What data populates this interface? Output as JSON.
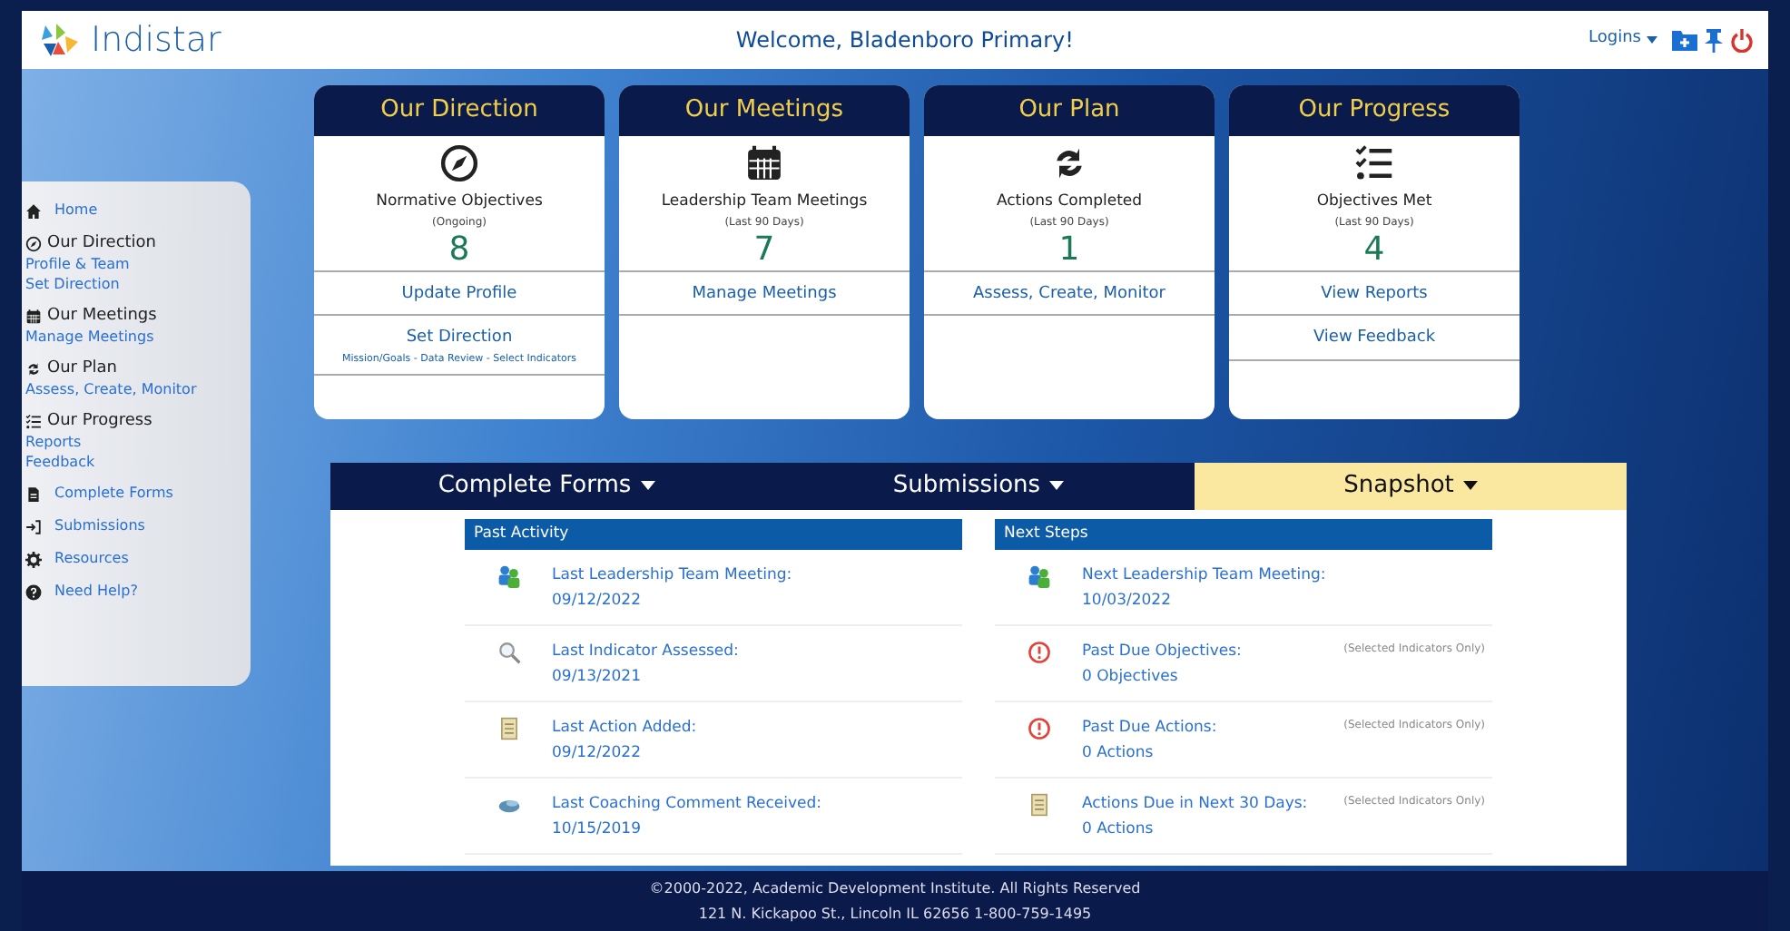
{
  "header": {
    "brand": "Indistar",
    "welcome": "Welcome, Bladenboro Primary!",
    "logins": "Logins"
  },
  "sidebar": [
    {
      "kind": "icon-link",
      "text": "Home"
    },
    {
      "kind": "heading",
      "text": "Our Direction"
    },
    {
      "kind": "sublink",
      "text": "Profile & Team"
    },
    {
      "kind": "sublink",
      "text": "Set Direction"
    },
    {
      "kind": "heading",
      "text": "Our Meetings"
    },
    {
      "kind": "sublink",
      "text": "Manage Meetings"
    },
    {
      "kind": "heading",
      "text": "Our Plan"
    },
    {
      "kind": "sublink",
      "text": "Assess, Create, Monitor"
    },
    {
      "kind": "heading",
      "text": "Our Progress"
    },
    {
      "kind": "sublink",
      "text": "Reports"
    },
    {
      "kind": "sublink",
      "text": "Feedback"
    },
    {
      "kind": "icon-link",
      "text": "Complete Forms"
    },
    {
      "kind": "icon-link",
      "text": "Submissions"
    },
    {
      "kind": "icon-link",
      "text": "Resources"
    },
    {
      "kind": "icon-link",
      "text": "Need Help?"
    }
  ],
  "cards": [
    {
      "title": "Our Direction",
      "stat": "Normative Objectives",
      "period": "(Ongoing)",
      "value": "8",
      "links": [
        {
          "text": "Update Profile"
        },
        {
          "text": "Set Direction",
          "subtext": "Mission/Goals - Data Review - Select Indicators"
        }
      ]
    },
    {
      "title": "Our Meetings",
      "stat": "Leadership Team Meetings",
      "period": "(Last 90 Days)",
      "value": "7",
      "links": [
        {
          "text": "Manage Meetings"
        }
      ]
    },
    {
      "title": "Our Plan",
      "stat": "Actions Completed",
      "period": "(Last 90 Days)",
      "value": "1",
      "links": [
        {
          "text": "Assess, Create, Monitor"
        }
      ]
    },
    {
      "title": "Our Progress",
      "stat": "Objectives Met",
      "period": "(Last 90 Days)",
      "value": "4",
      "links": [
        {
          "text": "View Reports"
        },
        {
          "text": "View Feedback"
        }
      ]
    }
  ],
  "tabs": [
    {
      "label": "Complete Forms",
      "selected": false
    },
    {
      "label": "Submissions",
      "selected": false
    },
    {
      "label": "Snapshot",
      "selected": true
    }
  ],
  "panels": [
    {
      "title": "Past Activity",
      "rows": [
        {
          "kind": "meeting",
          "label": "Last Leadership Team Meeting:",
          "value": "09/12/2022"
        },
        {
          "kind": "search",
          "label": "Last Indicator Assessed:",
          "value": "09/13/2021"
        },
        {
          "kind": "note",
          "label": "Last Action Added:",
          "value": "09/12/2022"
        },
        {
          "kind": "comment",
          "label": "Last Coaching Comment Received:",
          "value": "10/15/2019"
        }
      ]
    },
    {
      "title": "Next Steps",
      "rows": [
        {
          "kind": "meeting",
          "label": "Next Leadership Team Meeting:",
          "value": "10/03/2022"
        },
        {
          "kind": "alert",
          "label": "Past Due Objectives:",
          "value": "0 Objectives",
          "note": "(Selected Indicators Only)"
        },
        {
          "kind": "alert",
          "label": "Past Due Actions:",
          "value": "0 Actions",
          "note": "(Selected Indicators Only)"
        },
        {
          "kind": "note",
          "label": "Actions Due in Next 30 Days:",
          "value": "0 Actions",
          "note": "(Selected Indicators Only)"
        }
      ]
    }
  ],
  "footer": [
    "©2000-2022, Academic Development Institute. All Rights Reserved",
    "121 N. Kickapoo St., Lincoln IL 62656 1-800-759-1495"
  ]
}
